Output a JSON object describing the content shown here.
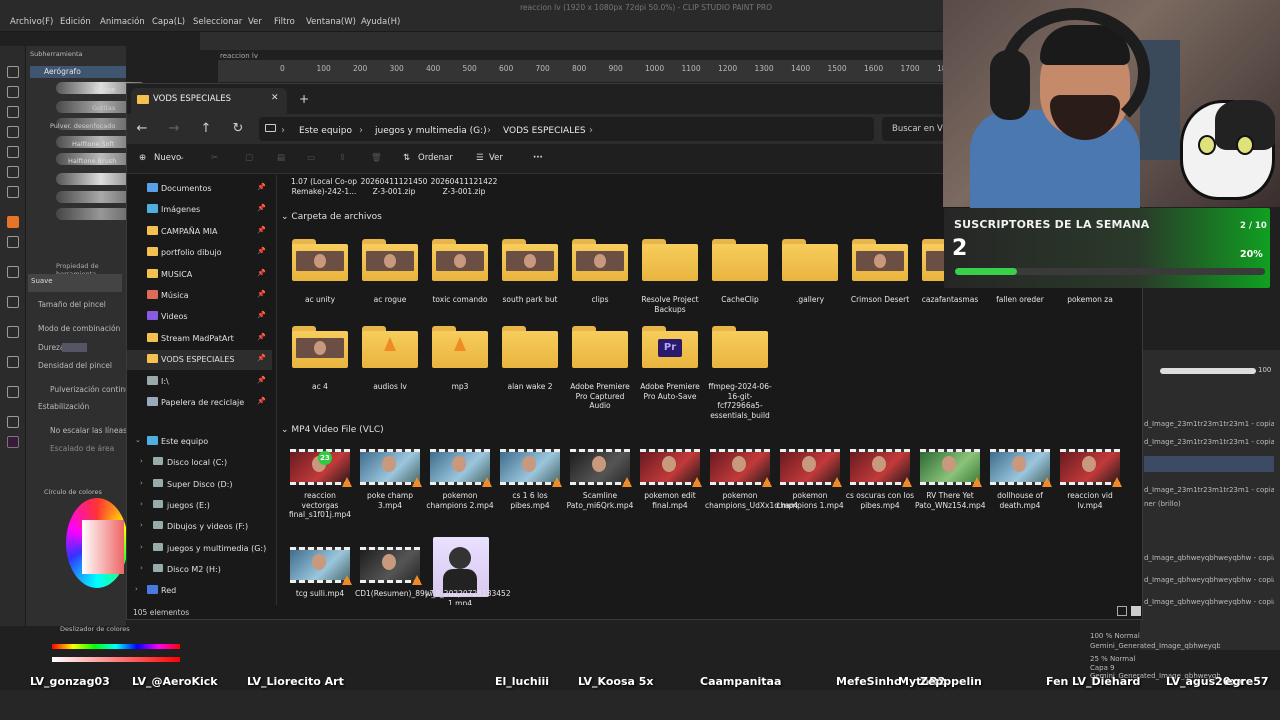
{
  "csp": {
    "window_title": "reaccion lv (1920 x 1080px 72dpi 50.0%) - CLIP STUDIO PAINT PRO",
    "menu": [
      "Archivo(F)",
      "Edición",
      "Animación",
      "Capa(L)",
      "Seleccionar",
      "Ver",
      "Filtro",
      "Ventana(W)",
      "Ayuda(H)"
    ],
    "canvas_tab": "reaccion lv",
    "ruler_ticks": [
      "0",
      "100",
      "200",
      "300",
      "400",
      "500",
      "600",
      "700",
      "800",
      "900",
      "1000",
      "1100",
      "1200",
      "1300",
      "1400",
      "1500",
      "1600",
      "1700",
      "1800",
      "1900"
    ],
    "subtool_tabs": [
      "Subherramienta",
      "Pincel"
    ],
    "subtool_group": "Aerógrafo",
    "brushes": [
      "Suave",
      "Gotitas",
      "Pulver. desenfocado",
      "Halftone Soft",
      "Halftone Brush"
    ],
    "tool_property_title": "Propiedad de herramienta",
    "tool_property_name": "Suave",
    "props": [
      "Tamaño del pincel",
      "Modo de combinación",
      "Dureza",
      "Densidad del pincel",
      "Pulverización continua",
      "Estabilización",
      "No escalar las líneas de",
      "Escalado de área"
    ],
    "color_panel": "Círculo de colores",
    "slider_panel": "Deslizador de colores",
    "layers": [
      "d_Image_23m1tr23m1tr23m1 - copia 3",
      "d_Image_23m1tr23m1tr23m1 - copia",
      "d_Image_23m1tr23m1tr23m1 - copia 1",
      "ner (brillo)",
      "d_Image_qbhweyqbhweyqbhw - copia 2",
      "d_Image_qbhweyqbhweyqbhw - copia",
      "d_Image_qbhweyqbhweyqbhw - copia 3",
      "100 % Normal",
      "Gemini_Generated_Image_qbhweyqbhweyqbhw - copia 2",
      "25 % Normal",
      "Capa 9",
      "Gemini_Generated_Image_qbhweyqbhweyqbhw"
    ],
    "zoom_value": "100"
  },
  "explorer": {
    "tab_title": "VODS ESPECIALES",
    "new_tab": "+",
    "close": "✕",
    "breadcrumb": [
      "Este equipo",
      "juegos y multimedia (G:)",
      "VODS ESPECIALES"
    ],
    "search_placeholder": "Buscar en VODS ESPECIALES",
    "commands": {
      "new": "Nuevo",
      "sort": "Ordenar",
      "view": "Ver",
      "more": "···"
    },
    "sidebar": [
      {
        "label": "Documentos",
        "icon": "documents-icon",
        "color": "#5aa0e8",
        "pinned": true
      },
      {
        "label": "Imágenes",
        "icon": "images-icon",
        "color": "#4fb0e0",
        "pinned": true
      },
      {
        "label": "CAMPAÑA MIA",
        "icon": "folder-icon",
        "color": "#f2c14e",
        "pinned": true
      },
      {
        "label": "portfolio dibujo",
        "icon": "folder-icon",
        "color": "#f2c14e",
        "pinned": true
      },
      {
        "label": "MUSICA",
        "icon": "folder-icon",
        "color": "#f2c14e",
        "pinned": true
      },
      {
        "label": "Música",
        "icon": "music-icon",
        "color": "#e06a5a",
        "pinned": true
      },
      {
        "label": "Videos",
        "icon": "videos-icon",
        "color": "#8a5ae0",
        "pinned": true
      },
      {
        "label": "Stream MadPatArt",
        "icon": "folder-icon",
        "color": "#f2c14e",
        "pinned": true
      },
      {
        "label": "VODS ESPECIALES",
        "icon": "folder-icon",
        "color": "#f2c14e",
        "pinned": true
      },
      {
        "label": "I:\\",
        "icon": "drive-icon",
        "color": "#9aa",
        "pinned": true
      },
      {
        "label": "Papelera de reciclaje",
        "icon": "recycle-bin-icon",
        "color": "#9ab",
        "pinned": true
      }
    ],
    "tree": [
      {
        "label": "Este equipo",
        "icon": "pc-icon"
      },
      {
        "label": "Disco local (C:)",
        "icon": "drive-icon"
      },
      {
        "label": "Super Disco (D:)",
        "icon": "drive-icon"
      },
      {
        "label": "juegos (E:)",
        "icon": "drive-icon"
      },
      {
        "label": "Dibujos y videos (F:)",
        "icon": "drive-icon"
      },
      {
        "label": "juegos y multimedia (G:)",
        "icon": "drive-icon"
      },
      {
        "label": "Disco M2 (H:)",
        "icon": "drive-icon"
      },
      {
        "label": "Red",
        "icon": "network-icon"
      }
    ],
    "status": "105 elementos",
    "top_partial": [
      {
        "label": "1.07 (Local Co-op Remake)-242-1..."
      },
      {
        "label": "20260411121450 Z-3-001.zip"
      },
      {
        "label": "20260411121422 Z-3-001.zip"
      }
    ],
    "section_folders": "Carpeta de archivos",
    "folders": [
      {
        "label": "ac unity",
        "kind": "photo"
      },
      {
        "label": "ac rogue",
        "kind": "photo"
      },
      {
        "label": "toxic comando",
        "kind": "photo"
      },
      {
        "label": "south park but",
        "kind": "photo"
      },
      {
        "label": "clips",
        "kind": "photo"
      },
      {
        "label": "Resolve Project Backups",
        "kind": "plain"
      },
      {
        "label": "CacheClip",
        "kind": "plain"
      },
      {
        "label": ".gallery",
        "kind": "plain"
      },
      {
        "label": "Crimson Desert",
        "kind": "photo"
      },
      {
        "label": "cazafantasmas",
        "kind": "photo"
      },
      {
        "label": "fallen oreder",
        "kind": "hidden"
      },
      {
        "label": "pokemon za",
        "kind": "hidden"
      },
      {
        "label": "ac 4",
        "kind": "photo"
      },
      {
        "label": "audios lv",
        "kind": "vlc"
      },
      {
        "label": "mp3",
        "kind": "vlc"
      },
      {
        "label": "alan wake 2",
        "kind": "plain"
      },
      {
        "label": "Adobe Premiere Pro Captured Audio",
        "kind": "plain"
      },
      {
        "label": "Adobe Premiere Pro Auto-Save",
        "kind": "premiere"
      },
      {
        "label": "ffmpeg-2024-06-16-git-fcf72966a5-essentials_build",
        "kind": "plain"
      }
    ],
    "section_videos": "MP4 Video File (VLC)",
    "videos": [
      {
        "label": "reaccion vectorgas final_s1f01j.mp4",
        "style": "red",
        "badge": "23"
      },
      {
        "label": "poke champ 3.mp4",
        "style": "blue"
      },
      {
        "label": "pokemon champions 2.mp4",
        "style": "blue"
      },
      {
        "label": "cs 1 6 los pibes.mp4",
        "style": "blue"
      },
      {
        "label": "Scamline Pato_mi6Qrk.mp4",
        "style": "dark"
      },
      {
        "label": "pokemon edit final.mp4",
        "style": "red"
      },
      {
        "label": "pokemon champions_UdXx1d.mp4",
        "style": "red"
      },
      {
        "label": "pokemon champions 1.mp4",
        "style": "red"
      },
      {
        "label": "cs oscuras con los pibes.mp4",
        "style": "red"
      },
      {
        "label": "RV There Yet Pato_WNz154.mp4",
        "style": "green"
      },
      {
        "label": "dollhouse of death.mp4",
        "style": "blue"
      },
      {
        "label": "reaccion vid lv.mp4",
        "style": "red"
      },
      {
        "label": "tcg sulli.mp4",
        "style": "blue"
      },
      {
        "label": "CD1(Resumen)_89y7Mm.mp4",
        "style": "dark"
      },
      {
        "label": "lv_0_20220728183452 1.mp4",
        "style": "portrait"
      }
    ]
  },
  "overlay": {
    "subs_title": "SUSCRIPTORES DE LA SEMANA",
    "subs_goal": "2 / 10",
    "subs_count": "2",
    "subs_percent": "20%",
    "subs_progress": 0.2,
    "viewers": [
      "LV_gonzag03",
      "LV_@AeroKick",
      "LV_Liorecito Art",
      "El_luchiii",
      "LV_Koosa 5x",
      "Caampanitaa",
      "MefeSinho",
      "MythR2",
      "Zepppelin",
      "Fen",
      "LV_Diehard",
      "LV_agus20xx",
      "egre57"
    ]
  }
}
